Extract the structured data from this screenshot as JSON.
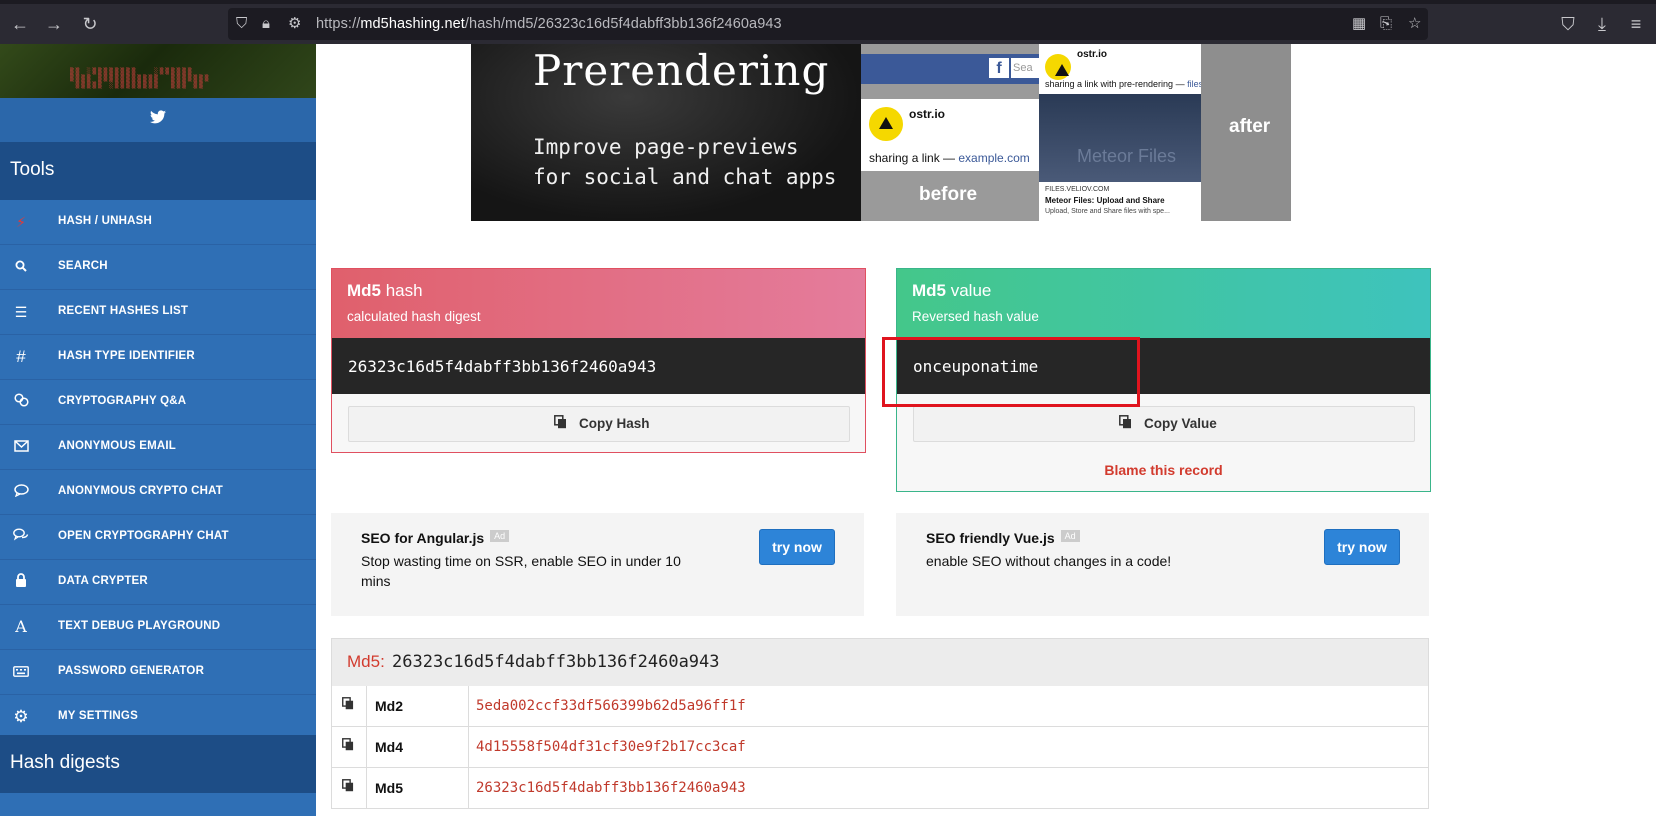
{
  "browser": {
    "url_prefix": "https://",
    "url_host": "md5hashing.net",
    "url_path": "/hash/md5/26323c16d5f4dabff3bb136f2460a943"
  },
  "sidebar": {
    "tools_title": "Tools",
    "digests_title": "Hash digests",
    "items": [
      {
        "label": "HASH / UNHASH",
        "icon": "bolt-icon"
      },
      {
        "label": "SEARCH",
        "icon": "search-icon"
      },
      {
        "label": "RECENT HASHES LIST",
        "icon": "list-icon"
      },
      {
        "label": "HASH TYPE IDENTIFIER",
        "icon": "hash-icon"
      },
      {
        "label": "CRYPTOGRAPHY Q&A",
        "icon": "chat-bubbles-icon"
      },
      {
        "label": "ANONYMOUS EMAIL",
        "icon": "envelope-icon"
      },
      {
        "label": "ANONYMOUS CRYPTO CHAT",
        "icon": "comment-icon"
      },
      {
        "label": "OPEN CRYPTOGRAPHY CHAT",
        "icon": "comments-icon"
      },
      {
        "label": "DATA CRYPTER",
        "icon": "lock-icon"
      },
      {
        "label": "TEXT DEBUG PLAYGROUND",
        "icon": "font-icon"
      },
      {
        "label": "PASSWORD GENERATOR",
        "icon": "keyboard-icon"
      },
      {
        "label": "MY SETTINGS",
        "icon": "gear-icon"
      }
    ]
  },
  "banner": {
    "heading": "Prerendering",
    "sub1": "Improve page-previews",
    "sub2": "for social and chat apps",
    "card1_name": "ostr.io",
    "card1_share": "sharing a link — ",
    "card1_link": "example.com",
    "before_label": "before",
    "card2_name": "ostr.io",
    "card2_share": "sharing a link with pre-rendering — ",
    "card2_link": "files.veliov.com",
    "card2_img_text": "Meteor Files",
    "card2_domain": "FILES.VELIOV.COM",
    "card2_title": "Meteor Files: Upload and Share",
    "card2_desc": "Upload, Store and Share files with spe...",
    "after_label": "after",
    "search_stub": "Sea"
  },
  "hash_box": {
    "title_bold": "Md5",
    "title_rest": " hash",
    "subtitle": "calculated hash digest",
    "value": "26323c16d5f4dabff3bb136f2460a943",
    "copy_label": "Copy Hash"
  },
  "value_box": {
    "title_bold": "Md5",
    "title_rest": " value",
    "subtitle": "Reversed hash value",
    "value": "onceuponatime",
    "copy_label": "Copy Value",
    "blame_label": "Blame this record"
  },
  "ads": [
    {
      "title": "SEO for Angular.js",
      "tag": "Ad",
      "desc": "Stop wasting time on SSR, enable SEO in under 10 mins",
      "button": "try now"
    },
    {
      "title": "SEO friendly Vue.js",
      "tag": "Ad",
      "desc": "enable SEO without changes in a code!",
      "button": "try now"
    }
  ],
  "digest_table": {
    "label": "Md5:",
    "hash": "26323c16d5f4dabff3bb136f2460a943",
    "rows": [
      {
        "algo": "Md2",
        "hash": "5eda002ccf33df566399b62d5a96ff1f"
      },
      {
        "algo": "Md4",
        "hash": "4d15558f504df31cf30e9f2b17cc3caf"
      },
      {
        "algo": "Md5",
        "hash": "26323c16d5f4dabff3bb136f2460a943"
      }
    ]
  }
}
